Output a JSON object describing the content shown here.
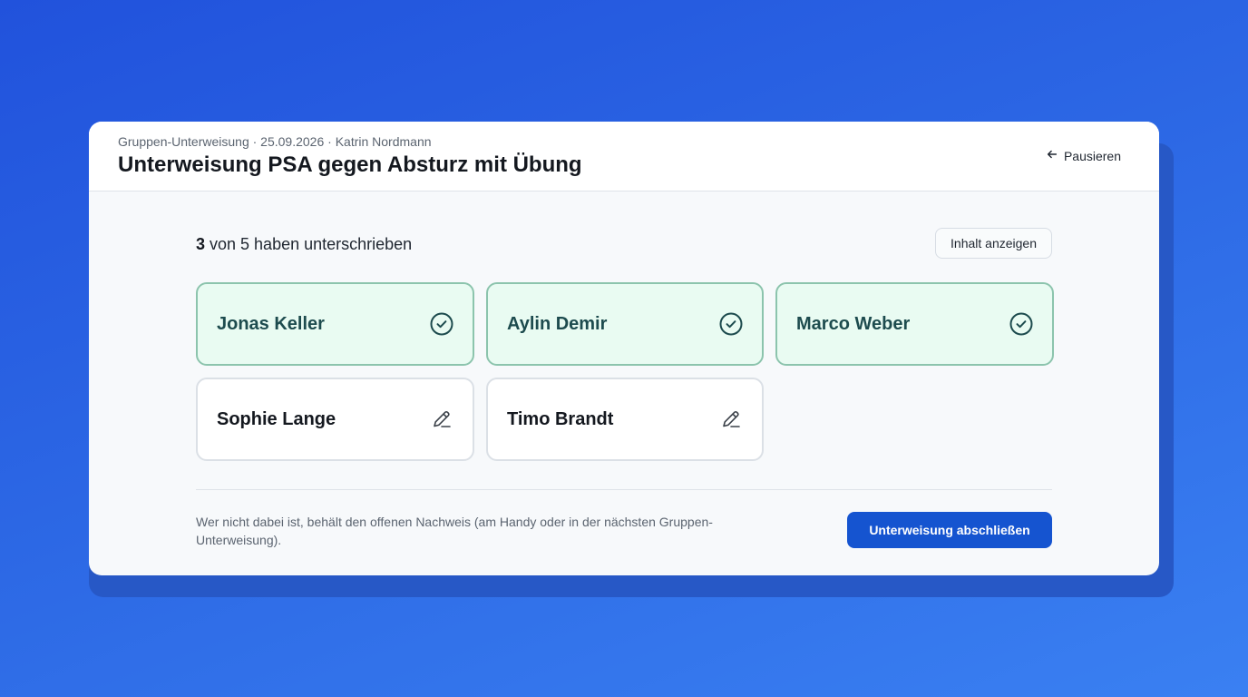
{
  "header": {
    "subtitle": "Gruppen-Unterweisung · 25.09.2026 · Katrin Nordmann",
    "title": "Unterweisung PSA gegen Absturz mit Übung",
    "pause_label": "Pausieren",
    "pause_icon": "arrow-left-icon"
  },
  "status": {
    "signed_count": "3",
    "rest_text": " von 5 haben unterschrieben"
  },
  "show_content_label": "Inhalt anzeigen",
  "participants": [
    {
      "name": "Jonas Keller",
      "state": "signed",
      "icon": "check-circle-icon"
    },
    {
      "name": "Aylin Demir",
      "state": "signed",
      "icon": "check-circle-icon"
    },
    {
      "name": "Marco Weber",
      "state": "signed",
      "icon": "check-circle-icon"
    },
    {
      "name": "Sophie Lange",
      "state": "open",
      "icon": "pen-icon"
    },
    {
      "name": "Timo Brandt",
      "state": "open",
      "icon": "pen-icon"
    }
  ],
  "footer": {
    "note": "Wer nicht dabei ist, behält den offenen Nachweis (am Handy oder in der nächsten Gruppen-Unterweisung).",
    "finish_label": "Unterweisung abschließen"
  },
  "colors": {
    "background": "#2e6be6",
    "primary_button": "#1554d0",
    "signed_fill": "#e9fbf2",
    "signed_border": "#8cc4ad",
    "signed_icon": "#1d4b4e"
  }
}
